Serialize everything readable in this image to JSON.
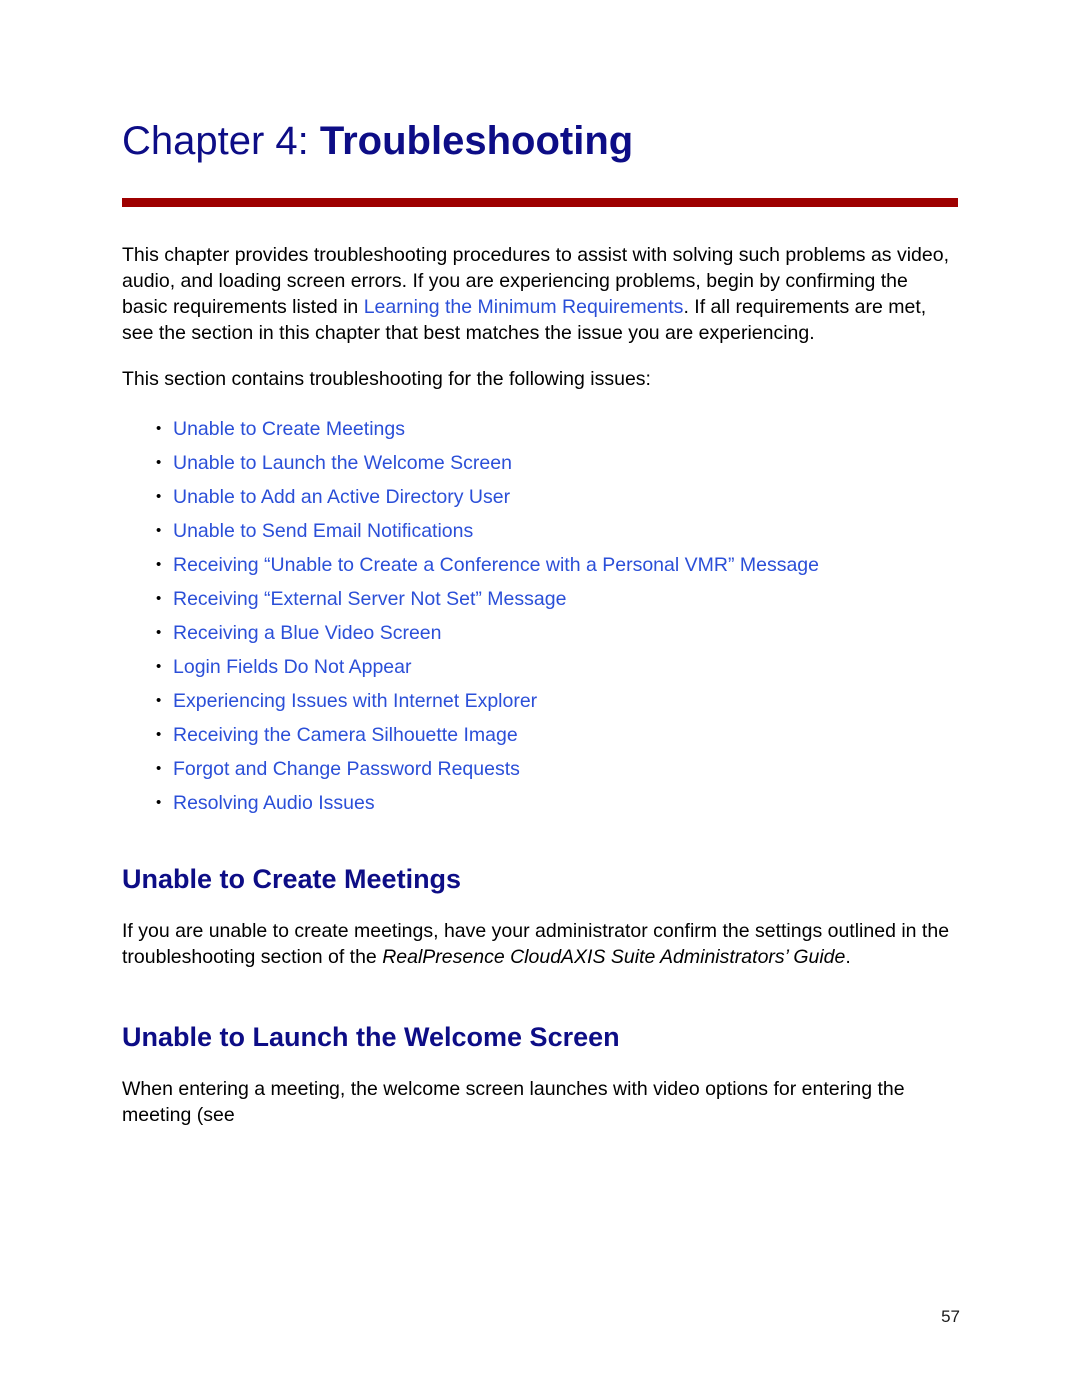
{
  "document": {
    "chapter_label": "Chapter 4: ",
    "chapter_name": "Troubleshooting"
  },
  "intro": {
    "part1": "This chapter provides troubleshooting procedures to assist with solving such problems as video, audio, and loading screen errors. If you are experiencing problems, begin by confirming the basic requirements listed in ",
    "link": "Learning the Minimum Requirements",
    "part2": ". If all requirements are met, see the section in this chapter that best matches the issue you are experiencing.",
    "lead_in": "This section contains troubleshooting for the following issues:"
  },
  "issue_links": [
    {
      "bullet": "•",
      "label": "Unable to Create Meetings"
    },
    {
      "bullet": "•",
      "label": "Unable to Launch the Welcome Screen"
    },
    {
      "bullet": "•",
      "label": "Unable to Add an Active Directory User"
    },
    {
      "bullet": "•",
      "label": "Unable to Send Email Notifications"
    },
    {
      "bullet": "•",
      "label": "Receiving “Unable to Create a Conference with a Personal VMR” Message"
    },
    {
      "bullet": "•",
      "label": "Receiving “External Server Not Set” Message"
    },
    {
      "bullet": "•",
      "label": "Receiving a Blue Video Screen"
    },
    {
      "bullet": "•",
      "label": "Login Fields Do Not Appear"
    },
    {
      "bullet": "•",
      "label": "Experiencing Issues with Internet Explorer"
    },
    {
      "bullet": "•",
      "label": "Receiving the Camera Silhouette Image"
    },
    {
      "bullet": "•",
      "label": "Forgot and Change Password Requests"
    },
    {
      "bullet": "•",
      "label": "Resolving Audio Issues"
    }
  ],
  "section_create_meetings": {
    "heading": "Unable to Create Meetings",
    "body_part1": "If you are unable to create meetings, have your administrator confirm the settings outlined in the troubleshooting section of the ",
    "body_italic": "RealPresence CloudAXIS Suite Administrators’ Guide",
    "body_part2": "."
  },
  "section_welcome_screen": {
    "heading": "Unable to Launch the Welcome Screen",
    "body": "When entering a meeting, the welcome screen launches with video options for entering the meeting (see"
  },
  "footer": {
    "page_number": "57"
  },
  "colors": {
    "heading_navy": "#0d0d86",
    "link_blue": "#2b4fd8",
    "rule_red": "#9e0000",
    "body_black": "#000000"
  }
}
